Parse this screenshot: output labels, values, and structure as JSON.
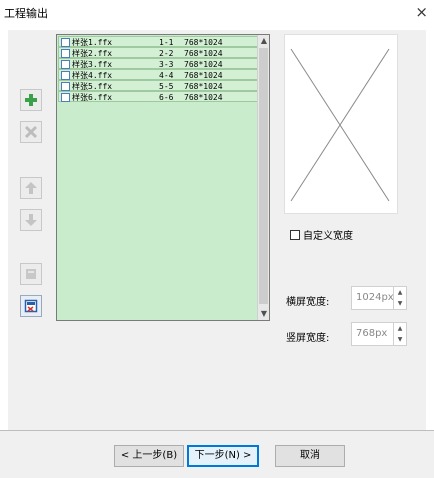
{
  "window": {
    "title": "工程输出",
    "close_icon": "×"
  },
  "toolbar": {
    "icons": [
      "add-icon",
      "remove-icon",
      "move-up-icon",
      "move-down-icon",
      "disabled-page-icon",
      "export-image-icon"
    ]
  },
  "file_list": {
    "rows": [
      {
        "name": "样张1.ffx",
        "pages": "1-1",
        "size": "768*1024"
      },
      {
        "name": "样张2.ffx",
        "pages": "2-2",
        "size": "768*1024"
      },
      {
        "name": "样张3.ffx",
        "pages": "3-3",
        "size": "768*1024"
      },
      {
        "name": "样张4.ffx",
        "pages": "4-4",
        "size": "768*1024"
      },
      {
        "name": "样张5.ffx",
        "pages": "5-5",
        "size": "768*1024"
      },
      {
        "name": "样张6.ffx",
        "pages": "6-6",
        "size": "768*1024"
      }
    ],
    "scroll_up": "▲",
    "scroll_down": "▼"
  },
  "options": {
    "custom_width_label": "自定义宽度",
    "landscape_width_label": "横屏宽度:",
    "landscape_width_value": "1024px",
    "portrait_width_label": "竖屏宽度:",
    "portrait_width_value": "768px",
    "spinner_up": "▲",
    "spinner_down": "▼"
  },
  "footer": {
    "prev_label": "< 上一步(B)",
    "next_label": "下一步(N) >",
    "cancel_label": "取消"
  },
  "colors": {
    "list_bg": "#c9eccc",
    "accent": "#0078d7",
    "add_green": "#3aa14a"
  }
}
